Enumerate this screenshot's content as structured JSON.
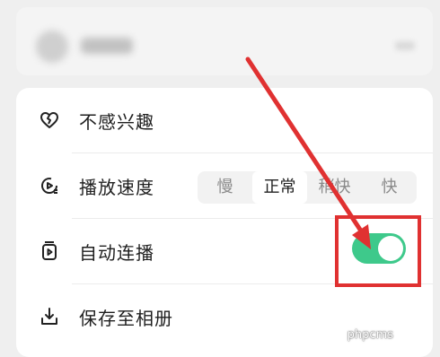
{
  "menu": {
    "items": [
      {
        "label": "不感兴趣",
        "icon": "heart-broken-icon"
      },
      {
        "label": "播放速度",
        "icon": "playback-speed-icon"
      },
      {
        "label": "自动连播",
        "icon": "autoplay-icon"
      },
      {
        "label": "保存至相册",
        "icon": "download-icon"
      }
    ]
  },
  "speed": {
    "options": [
      "慢",
      "正常",
      "稍快",
      "快"
    ],
    "selected": "正常"
  },
  "autoplay": {
    "enabled": true
  },
  "colors": {
    "toggle_on": "#3ec98b",
    "annotation_red": "#e03131"
  },
  "watermark": "phpcms"
}
